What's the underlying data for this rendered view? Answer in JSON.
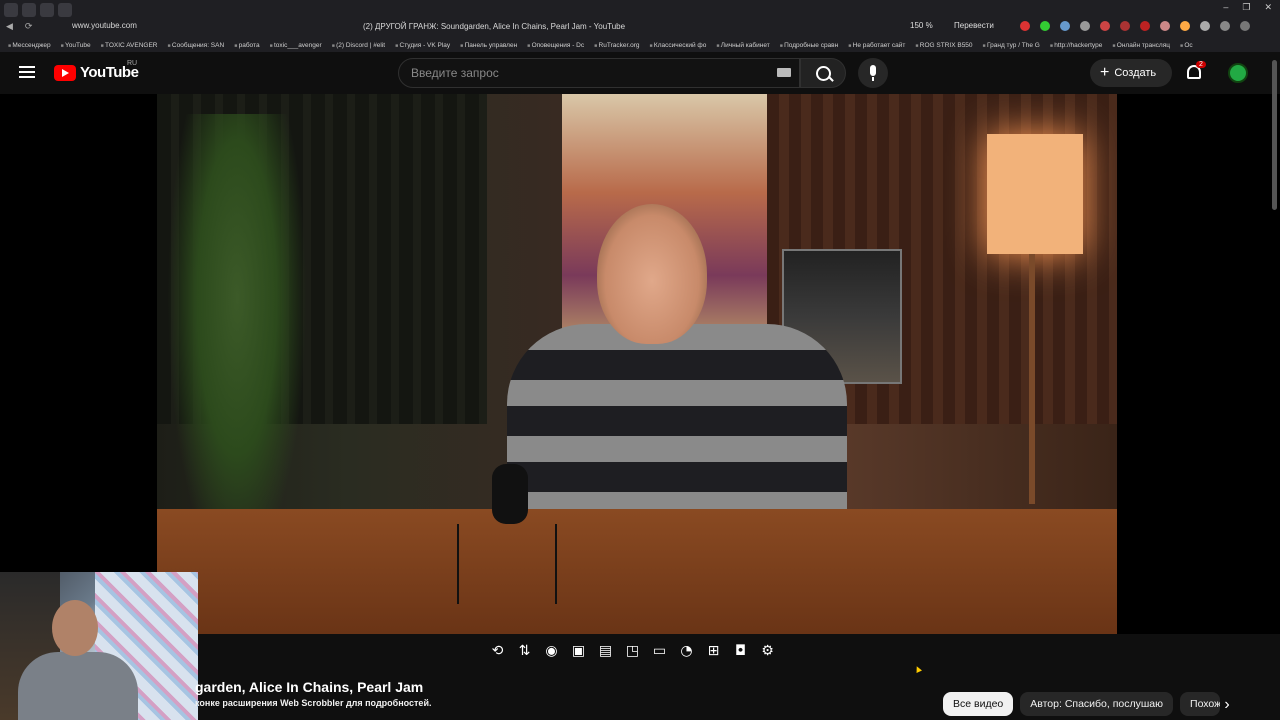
{
  "browser": {
    "url": "www.youtube.com",
    "tab_title": "(2) ДРУГОЙ ГРАНЖ: Soundgarden, Alice In Chains, Pearl Jam - YouTube",
    "zoom": "150 %",
    "translate_label": "Перевести",
    "bookmarks": [
      "Мессенджер",
      "YouTube",
      "TOXIC AVENGER",
      "Сообщения: SAN",
      "работа",
      "toxic___avenger",
      "(2) Discord | #elit",
      "Студия - VK Play",
      "Панель управлен",
      "Оповещения - Dc",
      "RuTracker.org",
      "Классический фо",
      "Личный кабинет",
      "Подробные сравн",
      "Не работает сайт",
      "ROG STRIX B550",
      "Гранд тур / The G",
      "http://hackertype",
      "Онлайн трансляц",
      "Ос"
    ]
  },
  "header": {
    "logo_text": "YouTube",
    "region": "RU",
    "search_placeholder": "Введите запрос",
    "create_label": "Создать",
    "notification_count": "2"
  },
  "player": {
    "title": "garden, Alice In Chains, Pearl Jam",
    "scrobbler_note": "конке расширения Web Scrobbler для подробностей."
  },
  "chips": {
    "all_videos": "Все видео",
    "author": "Автор: Спасибо, послушаю",
    "related": "Похожие"
  },
  "toolbar_icons": [
    "loop-icon",
    "sort-icon",
    "broadcast-icon",
    "settings-video-icon",
    "clapper-icon",
    "pip-icon",
    "theater-icon",
    "speed-icon",
    "add-screen-icon",
    "screenshot-icon",
    "gear-icon"
  ]
}
